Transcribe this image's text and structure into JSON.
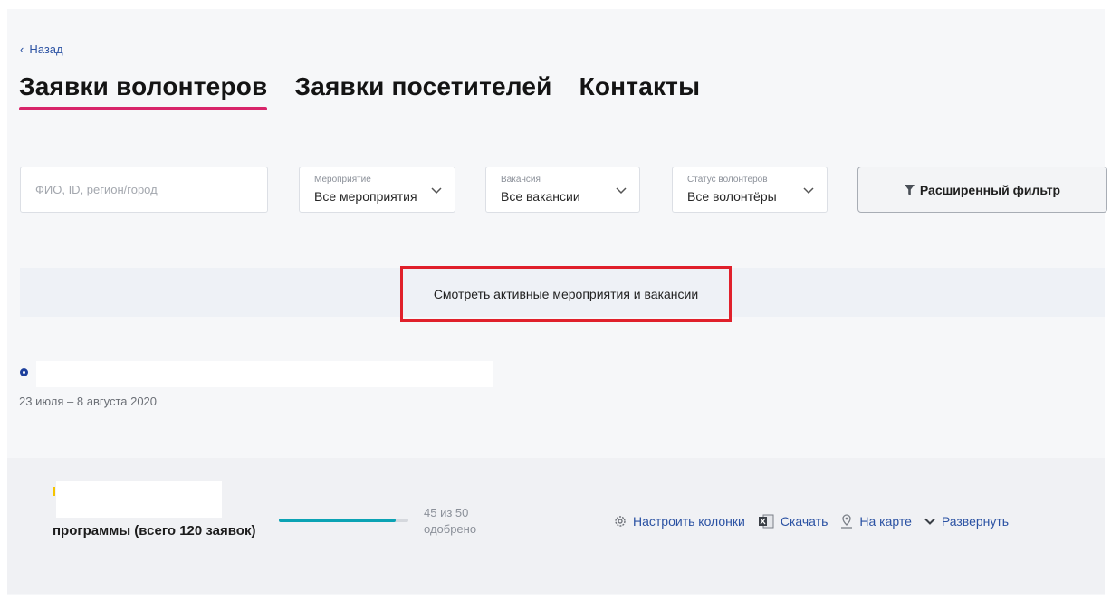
{
  "nav": {
    "back_label": "Назад"
  },
  "tabs": [
    {
      "label": "Заявки волонтеров",
      "active": true
    },
    {
      "label": "Заявки посетителей",
      "active": false
    },
    {
      "label": "Контакты",
      "active": false
    }
  ],
  "filters": {
    "search_placeholder": "ФИО, ID, регион/город",
    "event": {
      "label": "Мероприятие",
      "value": "Все мероприятия"
    },
    "vacancy": {
      "label": "Вакансия",
      "value": "Все вакансии"
    },
    "status": {
      "label": "Статус волонтёров",
      "value": "Все волонтёры"
    },
    "advanced_label": "Расширенный фильтр"
  },
  "banner": {
    "link_label": "Смотреть активные мероприятия и вакансии",
    "highlight_color": "#e0202b"
  },
  "event": {
    "dates": "23 июля – 8 августа 2020"
  },
  "program": {
    "title": "программы (всего 120 заявок)",
    "approved": 45,
    "total": 50,
    "count_line1": "45 из 50",
    "count_line2": "одобрено",
    "progress_color": "#0ba3b4"
  },
  "actions": [
    {
      "label": "Настроить колонки",
      "icon": "gear-icon"
    },
    {
      "label": "Скачать",
      "icon": "excel-icon"
    },
    {
      "label": "На карте",
      "icon": "map-pin-icon"
    },
    {
      "label": "Развернуть",
      "icon": "chevron-down-icon"
    }
  ],
  "colors": {
    "accent": "#d8256a",
    "link": "#2b52a3"
  }
}
